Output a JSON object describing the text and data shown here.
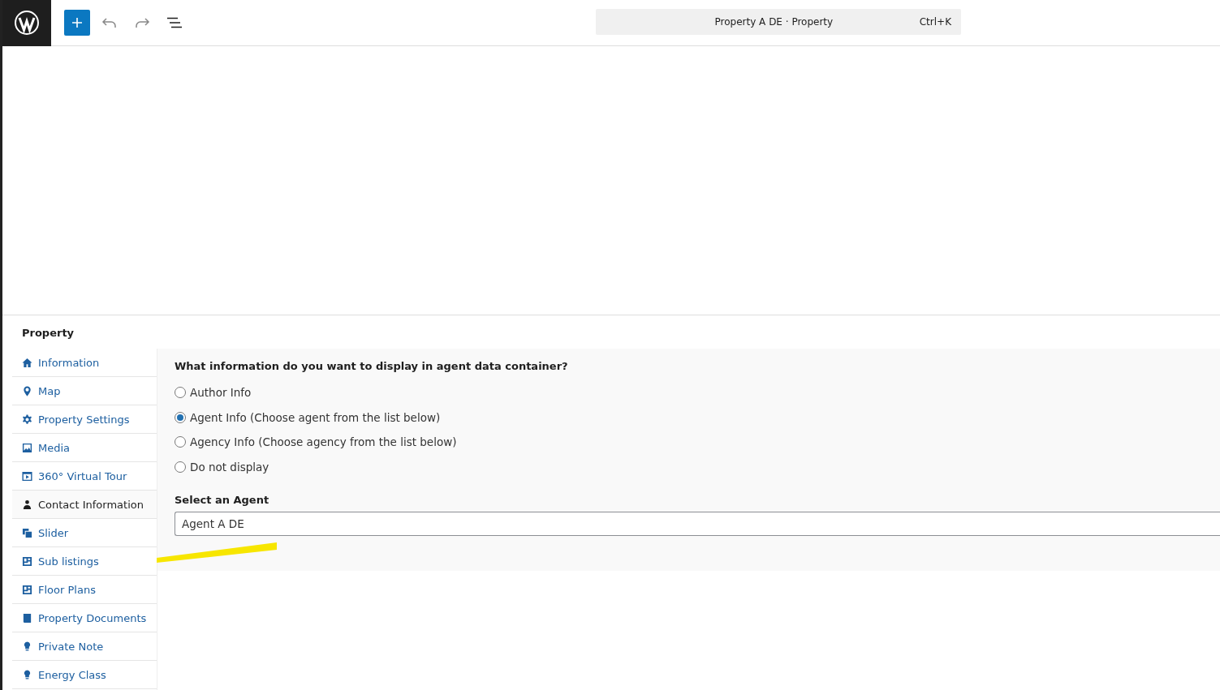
{
  "toolbar": {
    "title": "Property A DE · Property",
    "shortcut": "Ctrl+K"
  },
  "metabox": {
    "title": "Property",
    "tabs": [
      {
        "label": "Information",
        "selected": false
      },
      {
        "label": "Map",
        "selected": false
      },
      {
        "label": "Property Settings",
        "selected": false
      },
      {
        "label": "Media",
        "selected": false
      },
      {
        "label": "360° Virtual Tour",
        "selected": false
      },
      {
        "label": "Contact Information",
        "selected": true
      },
      {
        "label": "Slider",
        "selected": false
      },
      {
        "label": "Sub listings",
        "selected": false
      },
      {
        "label": "Floor Plans",
        "selected": false
      },
      {
        "label": "Property Documents",
        "selected": false
      },
      {
        "label": "Private Note",
        "selected": false
      },
      {
        "label": "Energy Class",
        "selected": false
      }
    ],
    "question": "What information do you want to display in agent data container?",
    "options": [
      {
        "label": "Author Info",
        "selected": false
      },
      {
        "label": "Agent Info (Choose agent from the list below)",
        "selected": true
      },
      {
        "label": "Agency Info (Choose agency from the list below)",
        "selected": false
      },
      {
        "label": "Do not display",
        "selected": false
      }
    ],
    "agent_label": "Select an Agent",
    "agent_value": "Agent A DE"
  }
}
